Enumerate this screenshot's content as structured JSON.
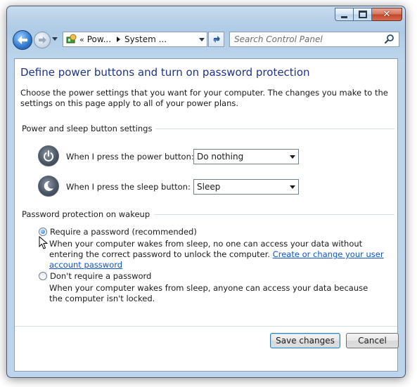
{
  "window": {
    "caption_buttons": {
      "minimize_icon": "minimize-icon",
      "maximize_icon": "maximize-icon",
      "close_glyph": "✕"
    }
  },
  "navbar": {
    "back_icon": "back-arrow-icon",
    "forward_icon": "forward-arrow-icon",
    "address": {
      "overflow_marker": "«",
      "crumbs": [
        "Pow...",
        "System ..."
      ]
    },
    "search": {
      "placeholder": "Search Control Panel"
    }
  },
  "page": {
    "title": "Define power buttons and turn on password protection",
    "intro": "Choose the power settings that you want for your computer. The changes you make to the settings on this page apply to all of your power plans.",
    "power_sleep_group": {
      "label": "Power and sleep button settings",
      "power_button": {
        "label": "When I press the power button:",
        "value": "Do nothing"
      },
      "sleep_button": {
        "label": "When I press the sleep button:",
        "value": "Sleep"
      }
    },
    "password_group": {
      "label": "Password protection on wakeup",
      "require": {
        "label": "Require a password (recommended)",
        "checked": true,
        "description": "When your computer wakes from sleep, no one can access your data without entering the correct password to unlock the computer.",
        "link": "Create or change your user account password"
      },
      "dont_require": {
        "label": "Don't require a password",
        "checked": false,
        "description": "When your computer wakes from sleep, anyone can access your data because the computer isn't locked."
      }
    },
    "buttons": {
      "save": "Save changes",
      "cancel": "Cancel"
    }
  },
  "colors": {
    "heading": "#1e3287",
    "link": "#0f54c8",
    "frame": "#b9d0e8"
  }
}
